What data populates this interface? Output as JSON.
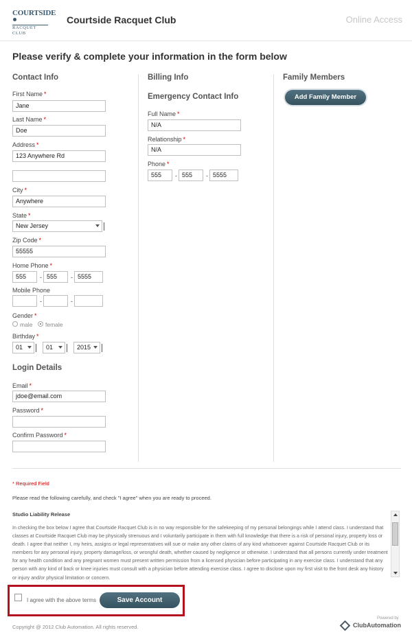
{
  "header": {
    "logo_line1": "COURTSIDE",
    "logo_line2": "RACQUET CLUB",
    "club_name": "Courtside Racquet Club",
    "online_access": "Online Access"
  },
  "page_title": "Please verify & complete your information in the form below",
  "contact": {
    "title": "Contact Info",
    "first_name_label": "First Name",
    "first_name": "Jane",
    "last_name_label": "Last Name",
    "last_name": "Doe",
    "address_label": "Address",
    "address1": "123 Anywhere Rd",
    "address2": "",
    "city_label": "City",
    "city": "Anywhere",
    "state_label": "State",
    "state": "New Jersey",
    "zip_label": "Zip Code",
    "zip": "55555",
    "home_phone_label": "Home Phone",
    "home_phone": [
      "555",
      "555",
      "5555"
    ],
    "mobile_phone_label": "Mobile Phone",
    "mobile_phone": [
      "",
      "",
      ""
    ],
    "gender_label": "Gender",
    "gender_male": "male",
    "gender_female": "female",
    "gender_selected": "female",
    "birthday_label": "Birthday",
    "birthday_month": "01",
    "birthday_day": "01",
    "birthday_year": "2015"
  },
  "login": {
    "title": "Login Details",
    "email_label": "Email",
    "email": "jdoe@email.com",
    "password_label": "Password",
    "confirm_label": "Confirm Password"
  },
  "billing": {
    "title": "Billing Info"
  },
  "emergency": {
    "title": "Emergency Contact Info",
    "full_name_label": "Full Name",
    "full_name": "N/A",
    "relationship_label": "Relationship",
    "relationship": "N/A",
    "phone_label": "Phone",
    "phone": [
      "555",
      "555",
      "5555"
    ]
  },
  "family": {
    "title": "Family Members",
    "add_button": "Add Family Member"
  },
  "footer_form": {
    "required_note": "Required Field",
    "read_note": "Please read the following carefully, and check \"I agree\" when you are ready to proceed.",
    "release_title": "Studio Liability Release",
    "release_text": "In checking the box below I agree that Courtside Racquet Club is in no way responsible for the safekeeping of my personal belongings while I attend class. I understand that classes at Courtside Racquet Club may be physically strenuous and I voluntarily participate in them with full knowledge that there is a risk of personal injury, property loss or death. I agree that neither I, my heirs, assigns or legal representatives will sue or make any other claims of any kind whatsoever against Courtside Racquet Club or its members for any personal injury, property damage/loss, or wrongful death, whether caused by negligence or otherwise. I understand that all persons currently under treatment for any health condition and any pregnant women must present written permission from a licensed physician before participating in any exercise class. I understand that any person with any kind of back or knee injuries must consult with a physician before attending exercise class. I agree to disclose upon my first visit to the front desk any history or injury and/or physical limitation or concern.",
    "agree_label": "I agree with the above terms",
    "save_button": "Save Account"
  },
  "page_footer": {
    "copyright": "Copyright @ 2012 Club Automation. All rights reserved.",
    "powered_by": "Powered by",
    "brand": "ClubAutomation"
  },
  "colors": {
    "button_bg": "#3f5d6b",
    "highlight_border": "#b3121c",
    "required": "#cc0000"
  }
}
